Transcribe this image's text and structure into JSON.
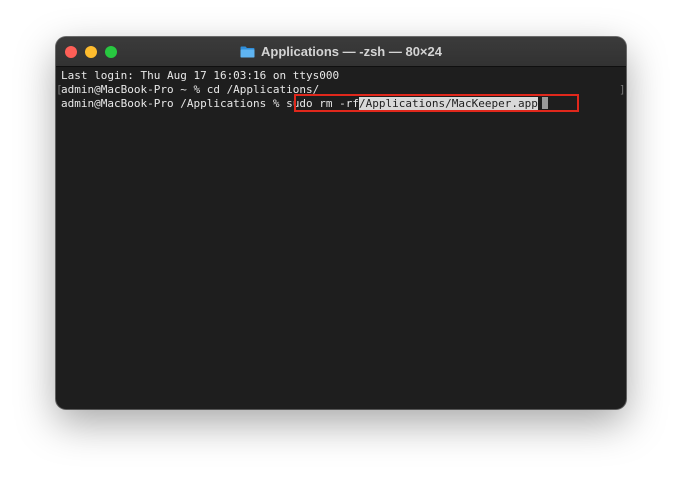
{
  "window": {
    "title": "Applications — -zsh — 80×24",
    "folder_icon": "folder-icon",
    "colors": {
      "close": "#fe5f57",
      "minimize": "#febc2e",
      "maximize": "#28c840",
      "highlight": "#e0281c"
    }
  },
  "terminal": {
    "lines": [
      "Last login: Thu Aug 17 16:03:16 on ttys000",
      "admin@MacBook-Pro ~ % cd /Applications/",
      "admin@MacBook-Pro /Applications % "
    ],
    "command_plain": "sudo rm -rf",
    "command_selected": "/Applications/MacKeeper.app",
    "bracket_left": "[",
    "bracket_right": "]"
  }
}
